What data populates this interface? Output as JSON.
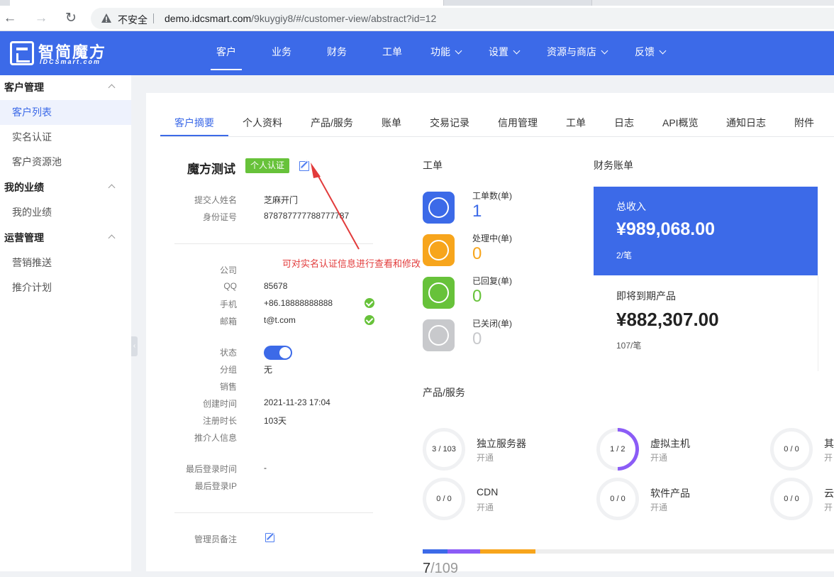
{
  "browser": {
    "security_label": "不安全",
    "url_host": "demo.idcsmart.com",
    "url_path": "/9kuygiy8/#/customer-view/abstract?id=12"
  },
  "header": {
    "logo_main": "智简魔方",
    "logo_sub": "IDCSmart.com",
    "nav": [
      {
        "label": "客户",
        "active": true
      },
      {
        "label": "业务"
      },
      {
        "label": "财务"
      },
      {
        "label": "工单"
      },
      {
        "label": "功能",
        "dropdown": true
      },
      {
        "label": "设置",
        "dropdown": true
      },
      {
        "label": "资源与商店",
        "dropdown": true
      },
      {
        "label": "反馈",
        "dropdown": true
      }
    ]
  },
  "sidebar": {
    "groups": [
      {
        "label": "客户管理",
        "items": [
          {
            "label": "客户列表",
            "active": true
          },
          {
            "label": "实名认证"
          },
          {
            "label": "客户资源池"
          }
        ]
      },
      {
        "label": "我的业绩",
        "items": [
          {
            "label": "我的业绩"
          }
        ]
      },
      {
        "label": "运营管理",
        "items": [
          {
            "label": "营销推送"
          },
          {
            "label": "推介计划"
          }
        ]
      }
    ]
  },
  "tabs": [
    "客户摘要",
    "个人资料",
    "产品/服务",
    "账单",
    "交易记录",
    "信用管理",
    "工单",
    "日志",
    "API概览",
    "通知日志",
    "附件"
  ],
  "customer": {
    "name": "魔方测试",
    "badge": "个人认证",
    "annotation": "可对实名认证信息进行查看和修改",
    "fields1": [
      {
        "label": "提交人姓名",
        "value": "芝麻开门"
      },
      {
        "label": "身份证号",
        "value": "878787777788777787"
      }
    ],
    "fields2": [
      {
        "label": "公司",
        "value": ""
      },
      {
        "label": "QQ",
        "value": "85678"
      },
      {
        "label": "手机",
        "value": "+86.18888888888"
      },
      {
        "label": "邮箱",
        "value": "t@t.com"
      }
    ],
    "fields3": [
      {
        "label": "状态",
        "value": ""
      },
      {
        "label": "分组",
        "value": "无"
      },
      {
        "label": "销售",
        "value": ""
      },
      {
        "label": "创建时间",
        "value": "2021-11-23 17:04"
      },
      {
        "label": "注册时长",
        "value": "103天"
      },
      {
        "label": "推介人信息",
        "value": ""
      }
    ],
    "fields4": [
      {
        "label": "最后登录时间",
        "value": "-"
      },
      {
        "label": "最后登录IP",
        "value": ""
      }
    ],
    "admin_note_label": "管理员备注",
    "status_enabled": true
  },
  "tickets": {
    "title": "工单",
    "items": [
      {
        "label": "工单数(单)",
        "value": "1",
        "color": "#3c6ae8"
      },
      {
        "label": "处理中(单)",
        "value": "0",
        "color": "#f7a51c"
      },
      {
        "label": "已回复(单)",
        "value": "0",
        "color": "#67c23a"
      },
      {
        "label": "已关闭(单)",
        "value": "0",
        "color": "#c8c9cc"
      }
    ]
  },
  "finance": {
    "title": "财务账单",
    "total_label": "总收入",
    "total_value": "¥989,068.00",
    "total_count": "2/笔",
    "expiring_label": "即将到期产品",
    "expiring_value": "¥882,307.00",
    "expiring_count": "107/笔"
  },
  "products": {
    "title": "产品/服务",
    "items": [
      {
        "name": "独立服务器",
        "status": "开通",
        "ratio": "3 / 103",
        "active": 3,
        "total": 103,
        "color": "#3c6ae8"
      },
      {
        "name": "虚拟主机",
        "status": "开通",
        "ratio": "1 / 2",
        "active": 1,
        "total": 2,
        "color": "#8b5cf6"
      },
      {
        "name": "其",
        "status": "开",
        "ratio": "0 / 0",
        "active": 0,
        "total": 0,
        "color": "#f7a51c"
      },
      {
        "name": "CDN",
        "status": "开通",
        "ratio": "0 / 0",
        "active": 0,
        "total": 0,
        "color": "#3c6ae8"
      },
      {
        "name": "软件产品",
        "status": "开通",
        "ratio": "0 / 0",
        "active": 0,
        "total": 0,
        "color": "#3c6ae8"
      },
      {
        "name": "云",
        "status": "开",
        "ratio": "0 / 0",
        "active": 0,
        "total": 0,
        "color": "#3c6ae8"
      }
    ],
    "total_active": "7",
    "total_all": "/109"
  }
}
